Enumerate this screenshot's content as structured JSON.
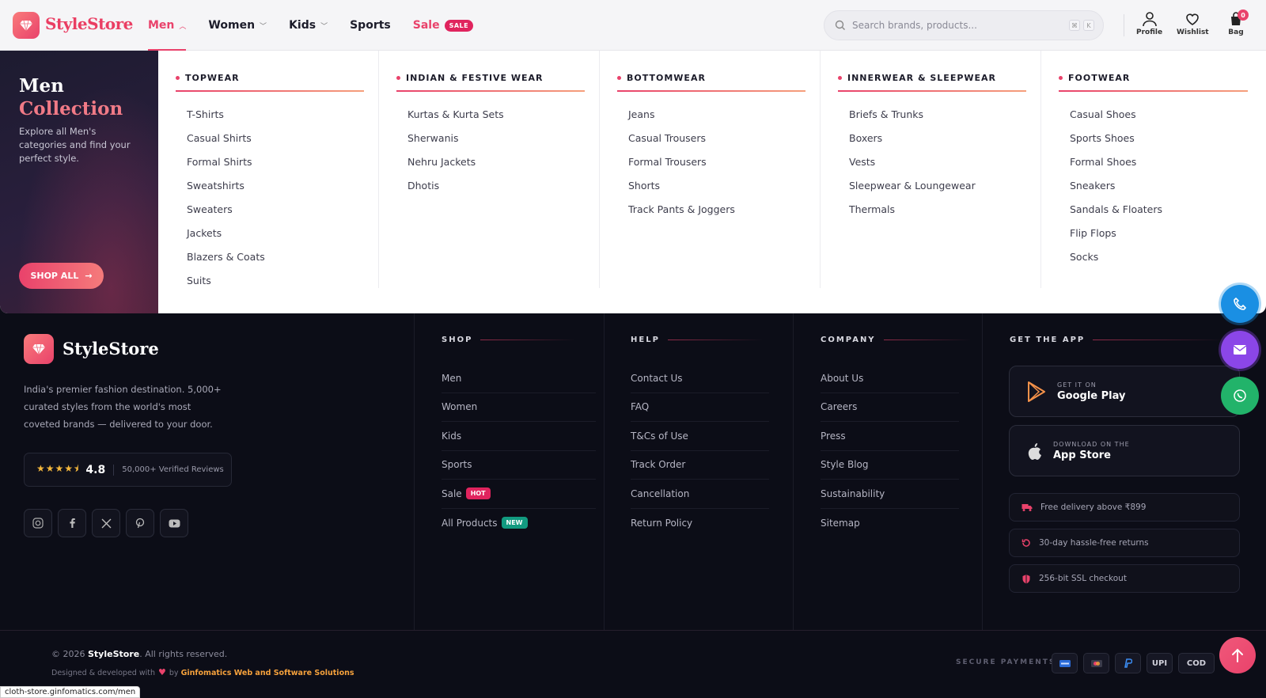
{
  "brand": {
    "name": "StyleStore"
  },
  "nav": {
    "men": "Men",
    "women": "Women",
    "kids": "Kids",
    "sports": "Sports",
    "sale": "Sale",
    "sale_badge": "SALE"
  },
  "search": {
    "placeholder": "Search brands, products...",
    "kbd1": "⌘",
    "kbd2": "K"
  },
  "header_icons": {
    "profile": "Profile",
    "wishlist": "Wishlist",
    "bag": "Bag",
    "bag_count": "0"
  },
  "mega": {
    "promo_title_1": "Men",
    "promo_title_2": "Collection",
    "promo_desc": "Explore all Men's categories and find your perfect style.",
    "shop_all": "SHOP ALL",
    "columns": [
      {
        "title": "TOPWEAR",
        "items": [
          "T-Shirts",
          "Casual Shirts",
          "Formal Shirts",
          "Sweatshirts",
          "Sweaters",
          "Jackets",
          "Blazers & Coats",
          "Suits"
        ]
      },
      {
        "title": "INDIAN & FESTIVE WEAR",
        "items": [
          "Kurtas & Kurta Sets",
          "Sherwanis",
          "Nehru Jackets",
          "Dhotis"
        ]
      },
      {
        "title": "BOTTOMWEAR",
        "items": [
          "Jeans",
          "Casual Trousers",
          "Formal Trousers",
          "Shorts",
          "Track Pants & Joggers"
        ]
      },
      {
        "title": "INNERWEAR & SLEEPWEAR",
        "items": [
          "Briefs & Trunks",
          "Boxers",
          "Vests",
          "Sleepwear & Loungewear",
          "Thermals"
        ]
      },
      {
        "title": "FOOTWEAR",
        "items": [
          "Casual Shoes",
          "Sports Shoes",
          "Formal Shoes",
          "Sneakers",
          "Sandals & Floaters",
          "Flip Flops",
          "Socks"
        ]
      }
    ]
  },
  "footer": {
    "brand": "StyleStore",
    "desc": "India's premier fashion destination. 5,000+ curated styles from the world's most coveted brands — delivered to your door.",
    "rating": "4.8",
    "stars": "★★★★⯨",
    "reviews": "50,000+ Verified Reviews",
    "shop": {
      "title": "SHOP",
      "items": [
        "Men",
        "Women",
        "Kids",
        "Sports",
        "Sale",
        "All Products"
      ],
      "sale_badge": "HOT",
      "all_badge": "NEW"
    },
    "help": {
      "title": "HELP",
      "items": [
        "Contact Us",
        "FAQ",
        "T&Cs of Use",
        "Track Order",
        "Cancellation",
        "Return Policy"
      ]
    },
    "company": {
      "title": "COMPANY",
      "items": [
        "About Us",
        "Careers",
        "Press",
        "Style Blog",
        "Sustainability",
        "Sitemap"
      ]
    },
    "app": {
      "title": "GET THE APP",
      "google_small": "GET IT ON",
      "google_big": "Google Play",
      "apple_small": "DOWNLOAD ON THE",
      "apple_big": "App Store"
    },
    "perks": [
      "Free delivery above ₹899",
      "30-day hassle-free returns",
      "256-bit SSL checkout"
    ],
    "copyright_prefix": "© 2026",
    "copyright_brand": "StyleStore",
    "copyright_suffix": ". All rights reserved.",
    "designed_prefix": "Designed & developed with",
    "designed_by": "by",
    "designed_company": "Ginfomatics Web and Software Solutions",
    "secure_payments": "SECURE PAYMENTS",
    "payments": [
      "UPI",
      "COD"
    ]
  },
  "status_url": "cloth-store.ginfomatics.com/men",
  "colors": {
    "accent": "#e9426b",
    "dark_bg": "#0c0d17",
    "phone": "#1a8fe3",
    "mail": "#8b46e8",
    "whatsapp": "#22b36a"
  }
}
